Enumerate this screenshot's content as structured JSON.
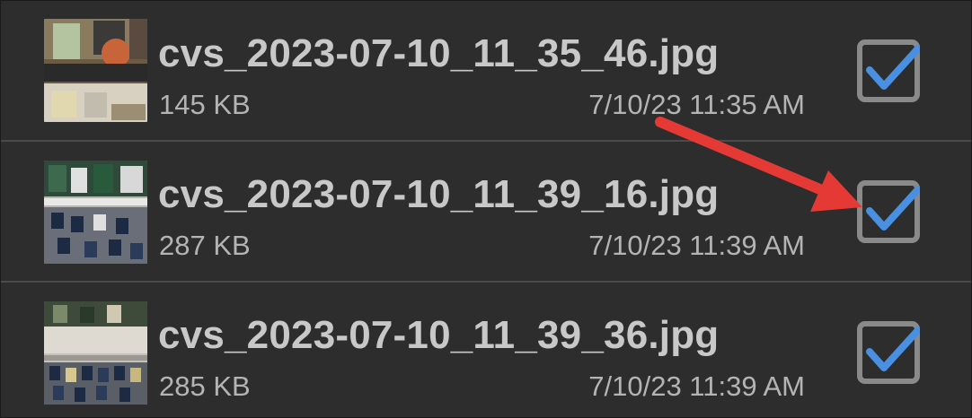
{
  "files": [
    {
      "name": "cvs_2023-07-10_11_35_46.jpg",
      "size": "145 KB",
      "date": "7/10/23 11:35 AM",
      "checked": true
    },
    {
      "name": "cvs_2023-07-10_11_39_16.jpg",
      "size": "287 KB",
      "date": "7/10/23 11:39 AM",
      "checked": true
    },
    {
      "name": "cvs_2023-07-10_11_39_36.jpg",
      "size": "285 KB",
      "date": "7/10/23 11:39 AM",
      "checked": true
    }
  ],
  "colors": {
    "background": "#2d2d2d",
    "filename_text": "#c8c8c8",
    "meta_text": "#b4b4b4",
    "checkbox_border": "#8a8a8a",
    "checkmark": "#4a90e2",
    "annotation_arrow": "#e53935"
  }
}
